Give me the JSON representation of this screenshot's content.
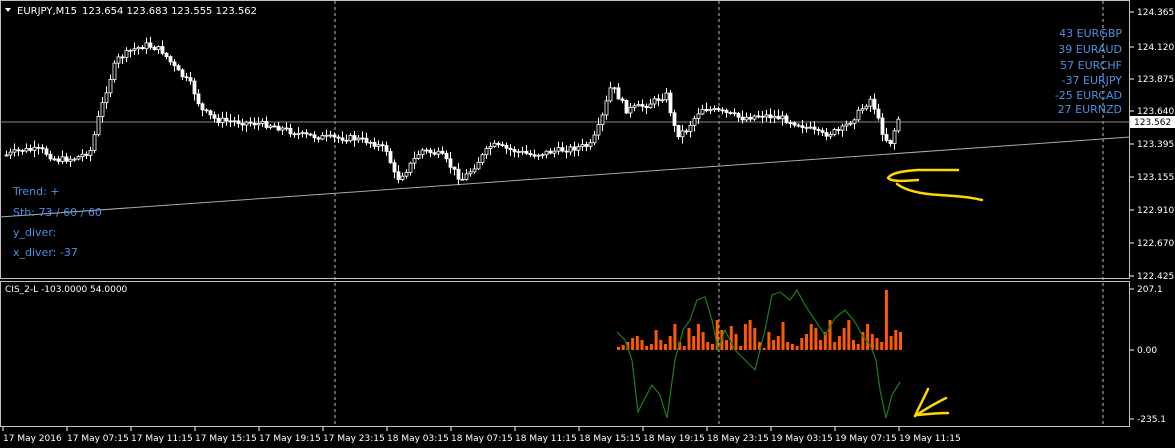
{
  "header": {
    "symbol": "EURJPY,M15",
    "ohlc": "123.654 123.683 123.555 123.562"
  },
  "price_axis": {
    "ticks": [
      "124.365",
      "124.120",
      "123.875",
      "123.640",
      "123.395",
      "123.155",
      "122.910",
      "122.670",
      "122.425"
    ],
    "current": "123.562"
  },
  "currency_strength": [
    {
      "value": 43,
      "pair": "EURGBP"
    },
    {
      "value": 39,
      "pair": "EURAUD"
    },
    {
      "value": 57,
      "pair": "EURCHF"
    },
    {
      "value": -37,
      "pair": "EURJPY"
    },
    {
      "value": -25,
      "pair": "EURCAD"
    },
    {
      "value": 27,
      "pair": "EURNZD"
    }
  ],
  "info_panel": {
    "trend": "Trend:  +",
    "sth": "Sth:  73 / 60 / 60",
    "y_diver": "y_diver:",
    "x_diver": "x_diver:  -37"
  },
  "indicator": {
    "label": "CIS_2-L -103.0000 54.0000",
    "ticks": [
      "207.1",
      "0.00",
      "-235.1"
    ]
  },
  "time_axis": {
    "labels": [
      "17 May 2016",
      "17 May 07:15",
      "17 May 11:15",
      "17 May 15:15",
      "17 May 19:15",
      "17 May 23:15",
      "18 May 03:15",
      "18 May 07:15",
      "18 May 11:15",
      "18 May 15:15",
      "18 May 19:15",
      "18 May 23:15",
      "19 May 03:15",
      "19 May 07:15",
      "19 May 11:15"
    ]
  },
  "colors": {
    "background": "#000000",
    "candle": "#ffffff",
    "histogram": "#ff5a00",
    "signal_line": "#1a7f1a",
    "annotation": "#ffd700",
    "strength_text": "#4a90e2"
  }
}
